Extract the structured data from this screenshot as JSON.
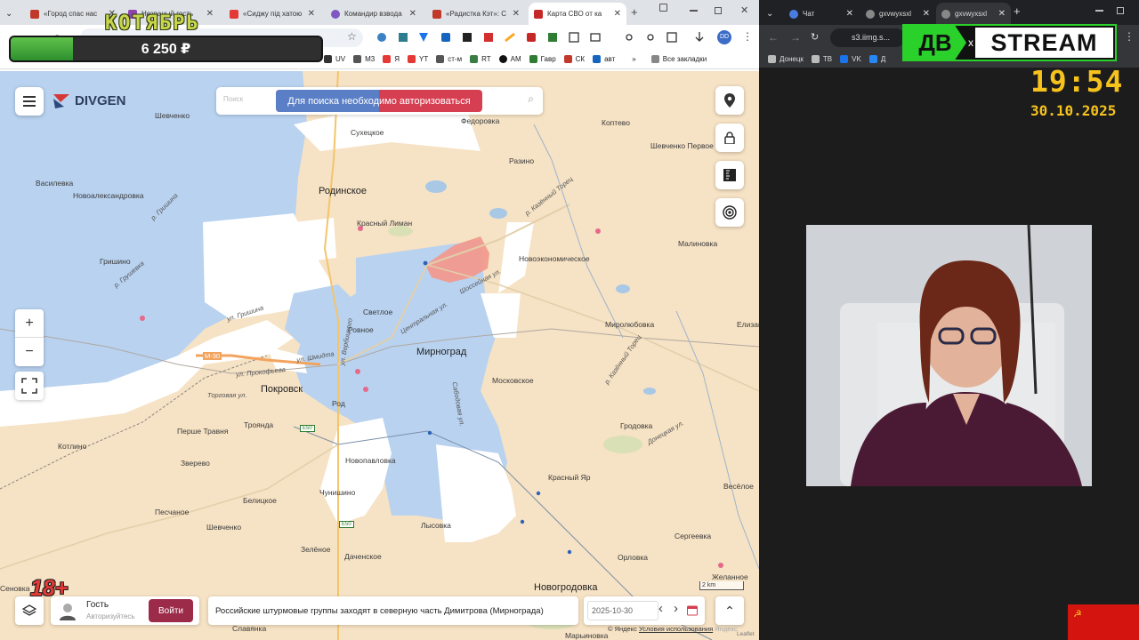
{
  "overlay": {
    "headline": "КОТЯБРЬ",
    "donation_amount": "6 250 ₽",
    "progress_fraction": 0.2,
    "age_rating": "18+"
  },
  "stream": {
    "logo_left": "ДВ",
    "logo_right": "STREAM",
    "logo_sep": "x",
    "time": "19:54",
    "date": "30.10.2025"
  },
  "left_browser": {
    "tabs": [
      {
        "label": "«Город спас нас",
        "color": "#c0392b"
      },
      {
        "label": "Незваный гость",
        "color": "#8e44ad"
      },
      {
        "label": "«Сиджу під хатою",
        "color": "#e53935"
      },
      {
        "label": "Командир взвода",
        "color": "#7e57c2"
      },
      {
        "label": "«Радистка Кэт»: С",
        "color": "#c0392b"
      },
      {
        "label": "Карта СВО от ка",
        "color": "#c62828"
      }
    ],
    "new_tab_symbol": "+",
    "bookmarks": [
      {
        "label": "UV",
        "color": "#333"
      },
      {
        "label": "М3",
        "color": "#555"
      },
      {
        "label": "Я",
        "color": "#e53935"
      },
      {
        "label": "YT",
        "color": "#e53935"
      },
      {
        "label": "ст-м",
        "color": "#555"
      },
      {
        "label": "RT",
        "color": "#3a7d44"
      },
      {
        "label": "АМ",
        "color": "#111"
      },
      {
        "label": "Гавр",
        "color": "#2e7d32"
      },
      {
        "label": "СК",
        "color": "#c0392b"
      },
      {
        "label": "авт",
        "color": "#1565c0"
      }
    ],
    "all_bookmarks": "Все закладки",
    "more_symbol": "»"
  },
  "map": {
    "logo": "DIVGEN",
    "auth_notice": "Для поиска необходимо авторизоваться",
    "search_placeholder": "Поиск",
    "labels": [
      {
        "text": "Шевченко",
        "cls": ""
      },
      {
        "text": "Сухецкое",
        "cls": ""
      },
      {
        "text": "Федоровка",
        "cls": ""
      },
      {
        "text": "Коптево",
        "cls": ""
      },
      {
        "text": "Шевченко Первое",
        "cls": ""
      },
      {
        "text": "Разино",
        "cls": ""
      },
      {
        "text": "Василевка",
        "cls": ""
      },
      {
        "text": "Новоалександровка",
        "cls": ""
      },
      {
        "text": "Родинское",
        "cls": "big"
      },
      {
        "text": "Красный Лиман",
        "cls": ""
      },
      {
        "text": "Малиновка",
        "cls": ""
      },
      {
        "text": "Гришино",
        "cls": ""
      },
      {
        "text": "Новоэкономическое",
        "cls": ""
      },
      {
        "text": "Светлое",
        "cls": ""
      },
      {
        "text": "Ровное",
        "cls": ""
      },
      {
        "text": "Мирноград",
        "cls": "big"
      },
      {
        "text": "Миролюбовка",
        "cls": ""
      },
      {
        "text": "Покровск",
        "cls": "big"
      },
      {
        "text": "Московское",
        "cls": ""
      },
      {
        "text": "Торговая ул.",
        "cls": "road"
      },
      {
        "text": "Род",
        "cls": ""
      },
      {
        "text": "Перше Травня",
        "cls": ""
      },
      {
        "text": "Троянда",
        "cls": ""
      },
      {
        "text": "Гродовка",
        "cls": ""
      },
      {
        "text": "Котлино",
        "cls": ""
      },
      {
        "text": "Зверево",
        "cls": ""
      },
      {
        "text": "Новопавловка",
        "cls": ""
      },
      {
        "text": "Красный Яр",
        "cls": ""
      },
      {
        "text": "Весёлое",
        "cls": ""
      },
      {
        "text": "Чунишино",
        "cls": ""
      },
      {
        "text": "Песчаное",
        "cls": ""
      },
      {
        "text": "Белицкое",
        "cls": ""
      },
      {
        "text": "Шевченко",
        "cls": ""
      },
      {
        "text": "Лысовка",
        "cls": ""
      },
      {
        "text": "Сергеевка",
        "cls": ""
      },
      {
        "text": "Зелёное",
        "cls": ""
      },
      {
        "text": "Даченское",
        "cls": ""
      },
      {
        "text": "Орловка",
        "cls": ""
      },
      {
        "text": "Желанное",
        "cls": ""
      },
      {
        "text": "Новогродовка",
        "cls": "big"
      },
      {
        "text": "Марьиновка",
        "cls": ""
      },
      {
        "text": "Сабодовая ул.",
        "cls": "road"
      },
      {
        "text": "Шоссейная ул.",
        "cls": "road"
      },
      {
        "text": "Центральная ул.",
        "cls": "road"
      },
      {
        "text": "ул. Шмидта",
        "cls": "road"
      },
      {
        "text": "ул. Прокофьева",
        "cls": "road"
      },
      {
        "text": "Донецкая ул.",
        "cls": "road"
      },
      {
        "text": "р. Казённый Торец",
        "cls": "road"
      },
      {
        "text": "р. Гришина",
        "cls": "road"
      },
      {
        "text": "ул. Гришина",
        "cls": "road"
      },
      {
        "text": "р. Грушевка",
        "cls": "road"
      },
      {
        "text": "Елизавет",
        "cls": ""
      },
      {
        "text": "Сеновка",
        "cls": ""
      },
      {
        "text": "Славянка",
        "cls": ""
      },
      {
        "text": "М-30",
        "cls": "road"
      },
      {
        "text": "Е50",
        "cls": "road"
      },
      {
        "text": "Е50",
        "cls": "road"
      },
      {
        "text": "ул. Вербицкого",
        "cls": "road"
      },
      {
        "text": "р. Казённый Торец",
        "cls": "road"
      }
    ],
    "scale_label": "2 km",
    "attribution": "© Яндекс",
    "terms_link": "Условия использования",
    "leaflet": "Leaflet",
    "yandex_logo": "Яндекс",
    "zoom_in": "+",
    "zoom_out": "−",
    "user": {
      "name": "Гость",
      "status": "Авторизуйтесь",
      "login_button": "Войти"
    },
    "news_text": "Российские штурмовые группы заходят в северную часть Димитрова (Мирнограда)",
    "date_value": "2025-10-30",
    "prev_symbol": "‹",
    "next_symbol": "›",
    "collapse_symbol": "⌃"
  },
  "right_browser": {
    "tabs": [
      {
        "label": "Чат"
      },
      {
        "label": "gxvwyxsxl"
      },
      {
        "label": "gxvwyxsxl"
      }
    ],
    "address": "s3.iimg.s...",
    "bookmarks": [
      {
        "label": "Донецк"
      },
      {
        "label": "ТВ"
      },
      {
        "label": "VK"
      },
      {
        "label": "Д"
      }
    ],
    "colors": {
      "flag": "#d3140f",
      "logo_green": "#2bd12b"
    }
  }
}
